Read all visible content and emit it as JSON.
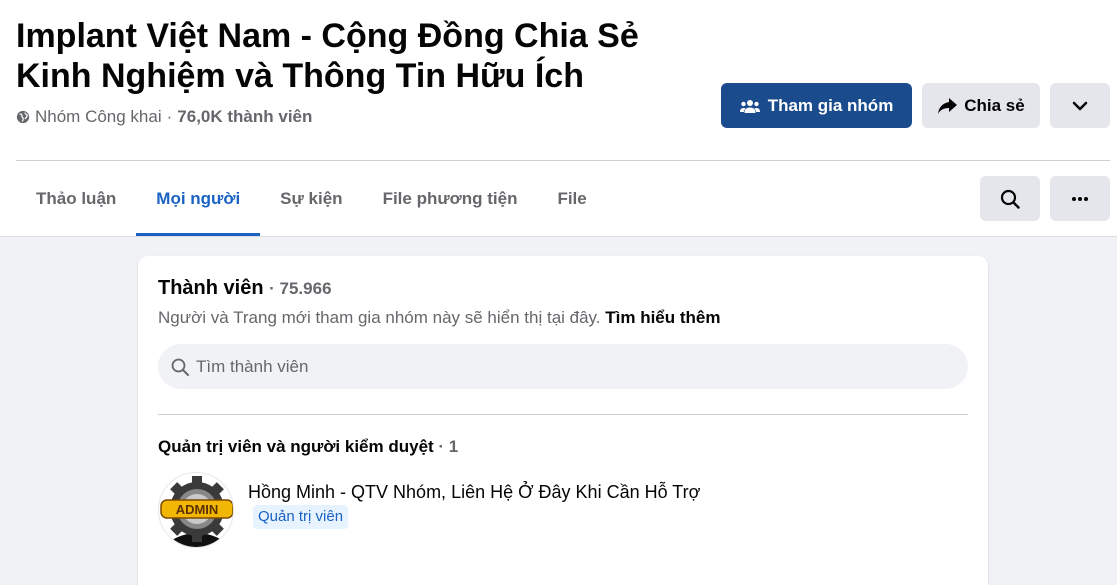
{
  "group": {
    "title": "Implant Việt Nam - Cộng Đồng Chia Sẻ Kinh Nghiệm và Thông Tin Hữu Ích",
    "privacy": "Nhóm Công khai",
    "separator": "·",
    "members": "76,0K thành viên",
    "privacy_icon": "globe-icon"
  },
  "actions": {
    "join_label": "Tham gia nhóm",
    "join_icon": "people-icon",
    "share_label": "Chia sẻ",
    "share_icon": "share-arrow-icon",
    "more_icon": "chevron-down-icon"
  },
  "tabs": [
    {
      "label": "Thảo luận",
      "active": false
    },
    {
      "label": "Mọi người",
      "active": true
    },
    {
      "label": "Sự kiện",
      "active": false
    },
    {
      "label": "File phương tiện",
      "active": false
    },
    {
      "label": "File",
      "active": false
    }
  ],
  "toolbar": {
    "search_icon": "search-icon",
    "more_icon": "more-dots-icon"
  },
  "members_card": {
    "title": "Thành viên",
    "count": "· 75.966",
    "subtitle": "Người và Trang mới tham gia nhóm này sẽ hiển thị tại đây.",
    "learn_more": "Tìm hiểu thêm",
    "search_placeholder": "Tìm thành viên",
    "admins_section": {
      "title": "Quản trị viên và người kiểm duyệt",
      "count": "· 1"
    },
    "admins": [
      {
        "name": "Hồng Minh - QTV Nhóm, Liên Hệ Ở Đây Khi Cần Hỗ Trợ",
        "role": "Quản trị viên",
        "avatar_text": "ADMIN"
      }
    ]
  },
  "colors": {
    "primary_button": "#1a4b8c",
    "active_tab": "#1a62c4",
    "secondary_button": "#e4e6eb",
    "page_background": "#f0f2f5",
    "badge_background": "#e7f3ff"
  }
}
